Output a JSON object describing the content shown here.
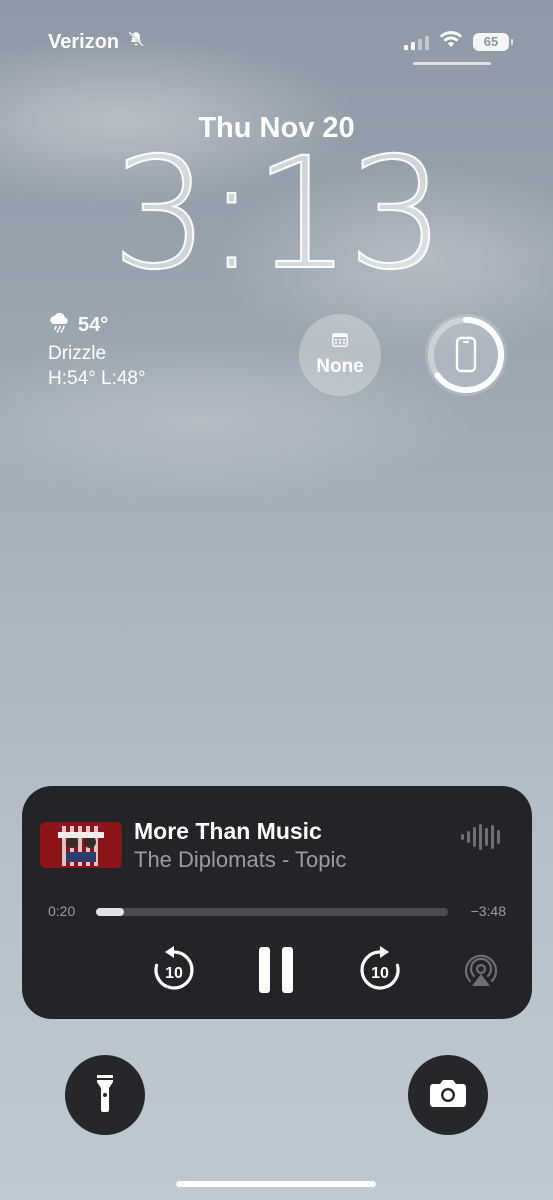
{
  "status_bar": {
    "carrier": "Verizon",
    "silent_icon": "bell-slash-icon",
    "battery_level": "65",
    "signal_bars": 2
  },
  "lock_screen": {
    "date": "Thu Nov 20",
    "time": "3:13"
  },
  "weather": {
    "icon": "cloud-drizzle-icon",
    "temperature": "54°",
    "condition": "Drizzle",
    "high_low": "H:54° L:48°"
  },
  "widgets": {
    "calendar_label": "None",
    "calendar_icon": "calendar-icon",
    "device_battery_icon": "iphone-icon"
  },
  "now_playing": {
    "title": "More Than Music",
    "artist": "The Diplomats - Topic",
    "elapsed": "0:20",
    "remaining": "−3:48",
    "progress_fraction": 0.08,
    "skip_back_seconds": "10",
    "skip_forward_seconds": "10"
  },
  "colors": {
    "player_bg": "#222427",
    "secondary_text": "#9a9ca0"
  }
}
